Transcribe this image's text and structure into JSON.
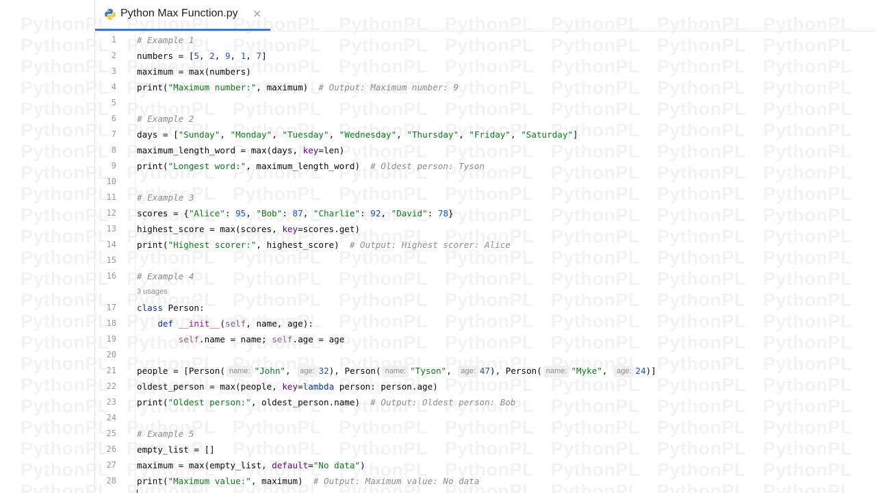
{
  "watermark": {
    "text": "PythonPL"
  },
  "editor": {
    "tab": {
      "title": "Python Max Function.py",
      "close_glyph": "×",
      "icon": "python-icon"
    },
    "accent_color": "#3574f0",
    "usages_hint": "3 usages",
    "line_numbers": [
      "1",
      "2",
      "3",
      "4",
      "5",
      "6",
      "7",
      "8",
      "9",
      "10",
      "11",
      "12",
      "13",
      "14",
      "15",
      "16",
      "17",
      "18",
      "19",
      "20",
      "21",
      "22",
      "23",
      "24",
      "25",
      "26",
      "27",
      "28"
    ],
    "lines": [
      "# Example 1",
      "numbers = [5, 2, 9, 1, 7]",
      "maximum = max(numbers)",
      "print(\"Maximum number:\", maximum)  # Output: Maximum number: 9",
      "",
      "# Example 2",
      "days = [\"Sunday\", \"Monday\", \"Tuesday\", \"Wednesday\", \"Thursday\", \"Friday\", \"Saturday\"]",
      "maximum_length_word = max(days, key=len)",
      "print(\"Longest word:\", maximum_length_word)  # Oldest person: Tyson",
      "",
      "# Example 3",
      "scores = {\"Alice\": 95, \"Bob\": 87, \"Charlie\": 92, \"David\": 78}",
      "highest_score = max(scores, key=scores.get)",
      "print(\"Highest scorer:\", highest_score)  # Output: Highest scorer: Alice",
      "",
      "# Example 4",
      "class Person:",
      "    def __init__(self, name, age):",
      "        self.name = name; self.age = age",
      "",
      "people = [Person( name: \"John\",  age: 32), Person( name: \"Tyson\",  age: 47), Person( name: \"Myke\",  age: 24)]",
      "oldest_person = max(people, key=lambda person: person.age)",
      "print(\"Oldest person:\", oldest_person.name)  # Output: Oldest person: Bob",
      "",
      "# Example 5",
      "empty_list = []",
      "maximum = max(empty_list, default=\"No data\")",
      "print(\"Maximum value:\", maximum)  # Output: Maximum value: No data"
    ]
  }
}
